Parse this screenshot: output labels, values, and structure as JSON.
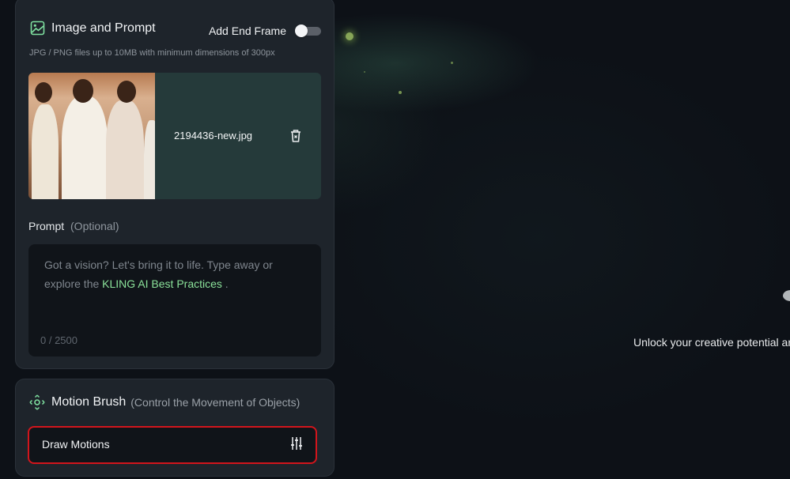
{
  "image_prompt": {
    "title": "Image and Prompt",
    "end_frame_label": "Add End Frame",
    "end_frame_enabled": false,
    "hint": "JPG / PNG files up to 10MB with minimum dimensions of 300px",
    "upload": {
      "filename": "2194436-new.jpg"
    },
    "prompt": {
      "label": "Prompt",
      "optional": "(Optional)",
      "placeholder_line1": "Got a vision? Let's bring it to life. Type away or",
      "placeholder_line2_prefix": "explore the",
      "placeholder_link": "KLING AI Best Practices",
      "placeholder_line2_suffix": ".",
      "counter": "0 / 2500"
    }
  },
  "motion_brush": {
    "title": "Motion Brush",
    "subtitle": "(Control the Movement of Objects)",
    "draw_button": "Draw Motions"
  },
  "right_panel": {
    "message": "Unlock your creative potential ar"
  },
  "colors": {
    "accent_green": "#8be29a",
    "highlight_red": "#d2151c",
    "panel_bg": "#1e242b"
  }
}
